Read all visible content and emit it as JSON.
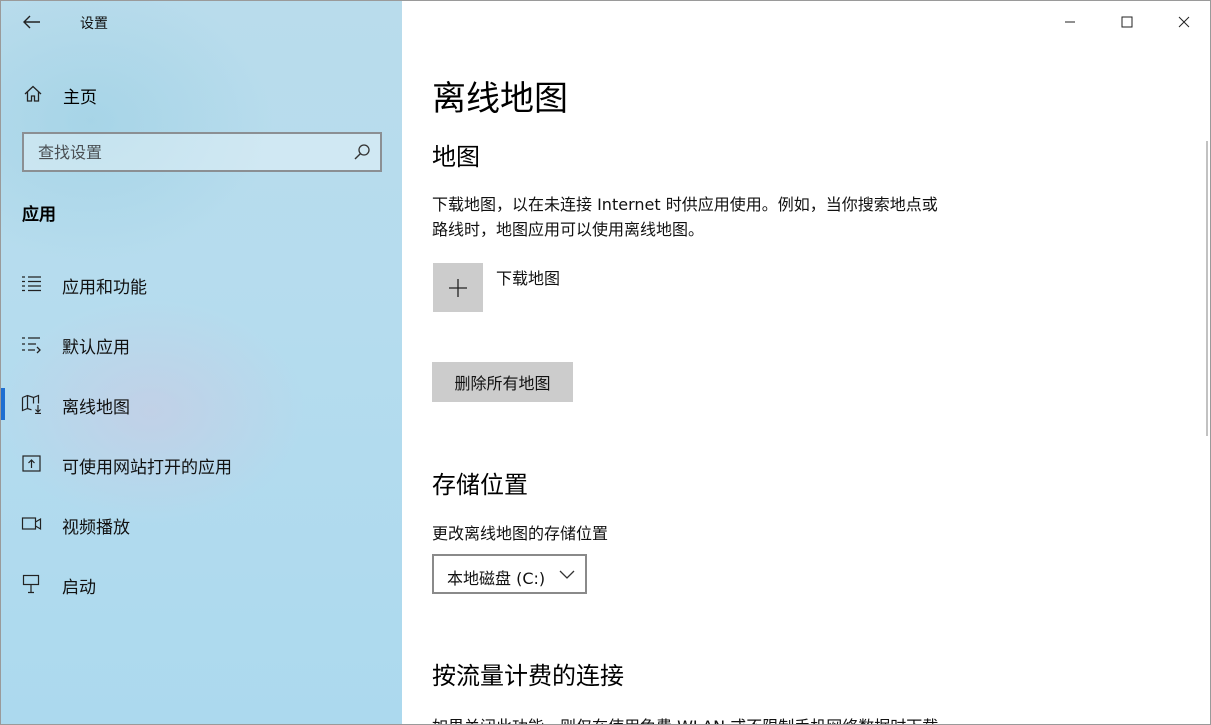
{
  "window": {
    "title": "设置",
    "controls": {
      "minimize": "minimize-icon",
      "maximize": "maximize-icon",
      "close": "close-icon"
    }
  },
  "sidebar": {
    "home_label": "主页",
    "search_placeholder": "查找设置",
    "section_title": "应用",
    "items": [
      {
        "label": "应用和功能",
        "icon": "apps-features-icon"
      },
      {
        "label": "默认应用",
        "icon": "default-apps-icon"
      },
      {
        "label": "离线地图",
        "icon": "offline-maps-icon",
        "selected": true
      },
      {
        "label": "可使用网站打开的应用",
        "icon": "apps-for-websites-icon"
      },
      {
        "label": "视频播放",
        "icon": "video-playback-icon"
      },
      {
        "label": "启动",
        "icon": "startup-icon"
      }
    ]
  },
  "main": {
    "page_title": "离线地图",
    "maps": {
      "heading": "地图",
      "description_line1": "下载地图，以在未连接 Internet 时供应用使用。例如，当你搜索地点或",
      "description_line2": "路线时，地图应用可以使用离线地图。",
      "download_label": "下载地图",
      "delete_all_label": "删除所有地图"
    },
    "storage": {
      "heading": "存储位置",
      "change_label": "更改离线地图的存储位置",
      "selected_drive": "本地磁盘 (C:)"
    },
    "metered": {
      "heading": "按流量计费的连接",
      "description_partial": "如果关闭此功能，则仅在使用免费 WLAN 或不限制手机网络数据时下载"
    }
  },
  "colors": {
    "accent": "#1f6fd1",
    "sidebar_bg": "#b5dcee",
    "tile_gray": "#cccccc"
  }
}
